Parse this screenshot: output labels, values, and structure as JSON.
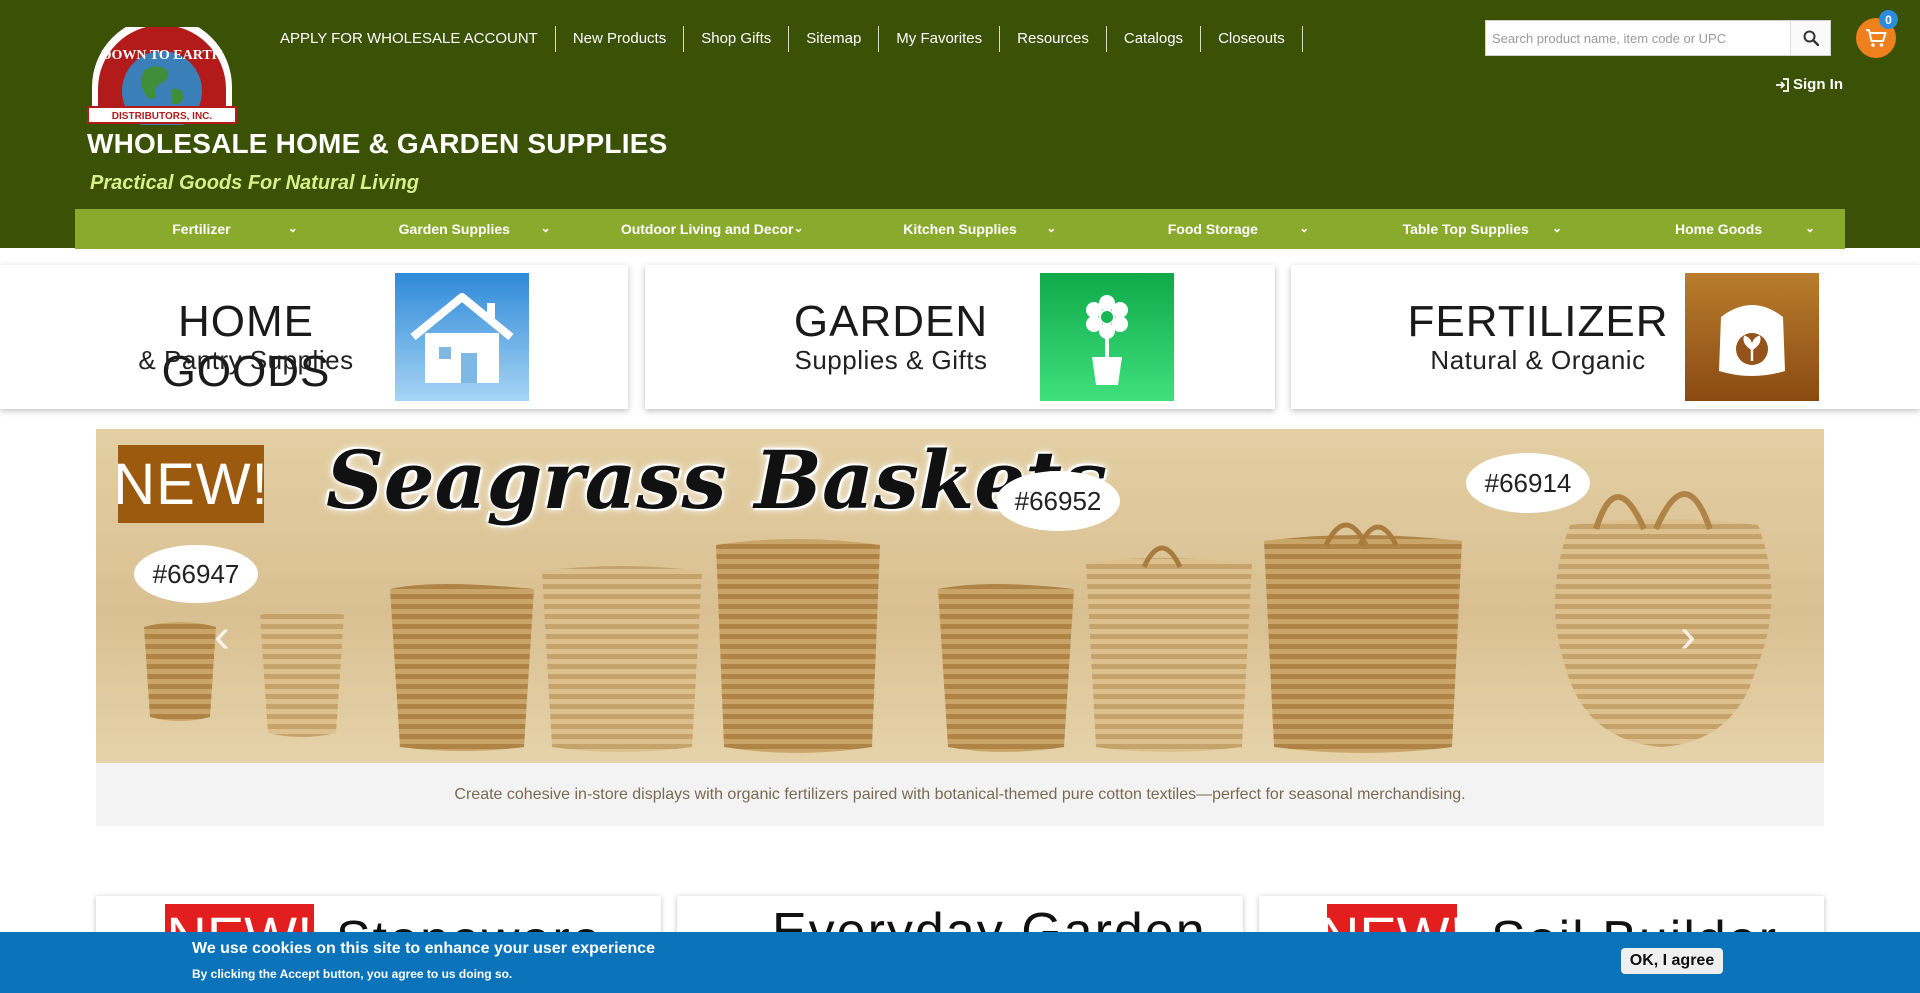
{
  "header": {
    "title": "WHOLESALE HOME & GARDEN SUPPLIES",
    "tagline": "Practical Goods For Natural Living",
    "logo_text_main": "DOWN TO EARTH",
    "logo_text_sub": "DISTRIBUTORS, INC.",
    "top_nav": [
      "APPLY FOR WHOLESALE ACCOUNT",
      "New Products",
      "Shop Gifts",
      "Sitemap",
      "My Favorites",
      "Resources",
      "Catalogs",
      "Closeouts"
    ],
    "search_placeholder": "Search product name, item code or UPC",
    "cart_count": "0",
    "sign_in": "Sign In"
  },
  "category_nav": [
    "Fertilizer",
    "Garden Supplies",
    "Outdoor Living and Decor",
    "Kitchen Supplies",
    "Food Storage",
    "Table Top Supplies",
    "Home Goods"
  ],
  "category_chevron": "⌄",
  "tiles": [
    {
      "big": "HOME GOODS",
      "small": "& Pantry Supplies",
      "icon": "house-icon",
      "color": "#4a9ad8"
    },
    {
      "big": "GARDEN",
      "small": "Supplies & Gifts",
      "icon": "flower-pot-icon",
      "color": "#1fbf55"
    },
    {
      "big": "FERTILIZER",
      "small": "Natural & Organic",
      "icon": "fertilizer-bag-icon",
      "color": "#a2601a"
    }
  ],
  "banner": {
    "badge": "NEW!",
    "title": "Seagrass Baskets",
    "codes": [
      "#66947",
      "#66952",
      "#66914"
    ],
    "prev_arrow": "‹",
    "next_arrow": "›",
    "caption": "Create cohesive in-store displays with organic fertilizers paired with botanical-themed pure cotton textiles—perfect for seasonal merchandising."
  },
  "lower_cards": [
    {
      "badge": "NEW!",
      "title": "Stoneware"
    },
    {
      "title": "Everyday Garden"
    },
    {
      "badge": "NEW!",
      "title": "Soil Builder"
    }
  ],
  "cookie": {
    "title": "We use cookies on this site to enhance your user experience",
    "subtitle": "By clicking the Accept button, you agree to us doing so.",
    "button": "OK, I agree"
  }
}
